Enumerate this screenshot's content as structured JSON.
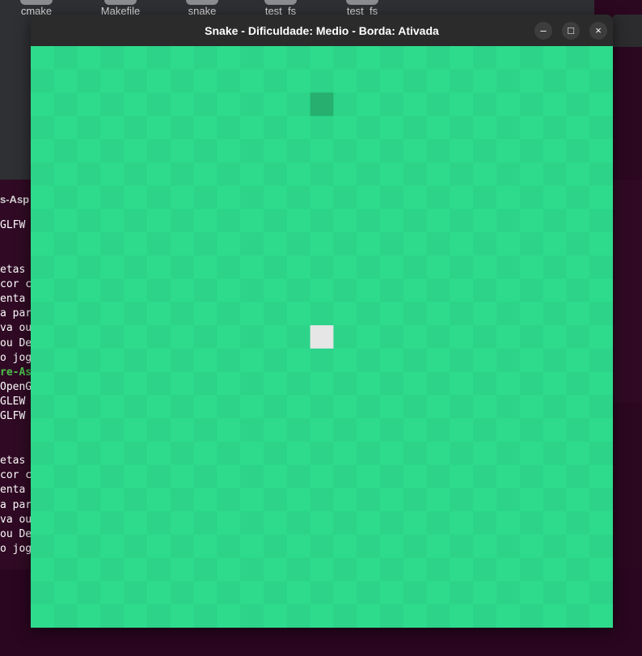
{
  "desktop": {
    "files": [
      {
        "label": "cmake\nin\ncr",
        "icon": "folder-icon"
      },
      {
        "label": "Makefile",
        "icon": "file-icon"
      },
      {
        "label": "snake",
        "icon": "executable-icon"
      },
      {
        "label": "test_fs",
        "icon": "file-icon"
      },
      {
        "label": "test_fs",
        "icon": "file-icon"
      }
    ]
  },
  "terminal": {
    "title": "s-Asp",
    "lines": [
      {
        "text": "GLFW",
        "style": "normal"
      },
      {
        "text": "",
        "style": "normal"
      },
      {
        "text": "",
        "style": "normal"
      },
      {
        "text": "etas",
        "style": "normal"
      },
      {
        "text": "cor c",
        "style": "normal"
      },
      {
        "text": "enta",
        "style": "normal"
      },
      {
        "text": "a par",
        "style": "normal"
      },
      {
        "text": "va ou",
        "style": "normal"
      },
      {
        "text": "ou De",
        "style": "normal"
      },
      {
        "text": "o jog",
        "style": "normal"
      },
      {
        "text": "re-As",
        "style": "green"
      },
      {
        "text": "OpenG",
        "style": "normal"
      },
      {
        "text": "GLEW",
        "style": "normal"
      },
      {
        "text": "GLFW",
        "style": "normal"
      },
      {
        "text": "",
        "style": "normal"
      },
      {
        "text": "",
        "style": "normal"
      },
      {
        "text": "etas",
        "style": "normal"
      },
      {
        "text": "cor c",
        "style": "normal"
      },
      {
        "text": "enta",
        "style": "normal"
      },
      {
        "text": "a par",
        "style": "normal"
      },
      {
        "text": "va ou",
        "style": "normal"
      },
      {
        "text": "ou De",
        "style": "normal"
      },
      {
        "text": "o jog",
        "style": "normal"
      }
    ]
  },
  "window": {
    "title": "Snake - Dificuldade: Medio - Borda: Ativada",
    "buttons": {
      "minimize": "–",
      "maximize": "□",
      "close": "×"
    }
  },
  "game": {
    "grid": {
      "cols": 25,
      "rows": 25
    },
    "colors": {
      "light": "#2edb8d",
      "dark": "#2cd389",
      "food": "#26af6e",
      "snake": "#e6e6e6"
    },
    "food": {
      "col": 12,
      "row": 2
    },
    "snake": [
      {
        "col": 12,
        "row": 12
      }
    ]
  }
}
